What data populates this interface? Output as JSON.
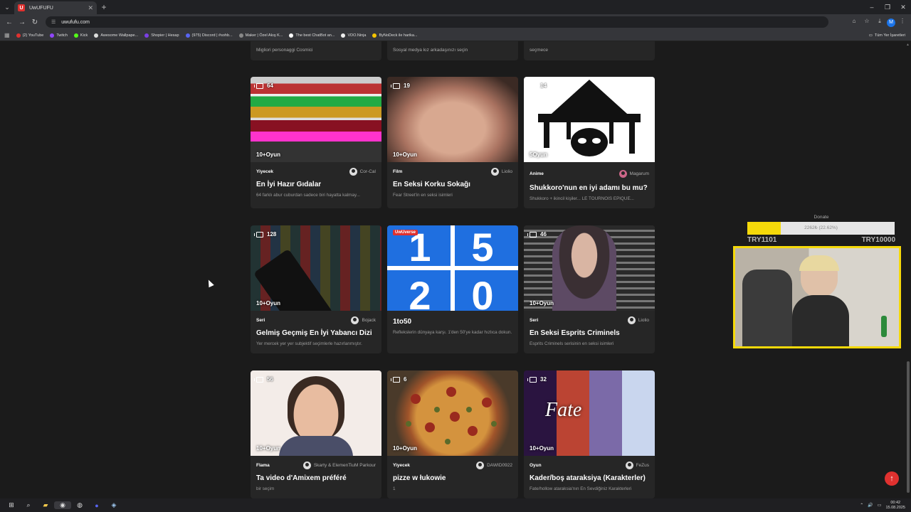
{
  "browser": {
    "tab_title": "UwUFUFU",
    "tab_favicon": "U",
    "url": "uwufufu.com",
    "profile_initial": "M",
    "bookmarks": [
      "(2) YouTube",
      "Twitch",
      "Kick",
      "Awesome Wallpape...",
      "Shopier | Hesap",
      "(975) Discord | #sohb...",
      "Maker | Özel Akış K...",
      "The best ChatBot an...",
      "VDO.Ninja",
      "ByNoDeck ile harika..."
    ],
    "bookmarks_all": "Tüm Yer İşaretleri"
  },
  "top_strip": [
    {
      "desc": "Migliori personaggi Cosmici"
    },
    {
      "desc": "Sosyal medya kız arkadaşınızı seçin"
    },
    {
      "desc": "seçmece"
    }
  ],
  "cards": [
    {
      "count": "64",
      "oyun": "10+Oyun",
      "category": "Yiyecek",
      "author": "Cor-Cal",
      "title": "En İyi Hazır Gıdalar",
      "desc": "64 farklı abur cuburdan sadece biri hayatta kalmay..."
    },
    {
      "count": "19",
      "oyun": "10+Oyun",
      "category": "Film",
      "author": "Liolio",
      "title": "En Seksi Korku Sokağı",
      "desc": "Fear Street'in en seksi isimleri"
    },
    {
      "count": "14",
      "oyun": "5Oyun",
      "category": "Anime",
      "author": "Magarum",
      "title": "Shukkoro'nun en iyi adamı bu mu?",
      "desc": "Shukkoro + ikincil kişiler... LE TOURNOIS EPIQUE..."
    },
    {
      "count": "128",
      "oyun": "10+Oyun",
      "category": "Seri",
      "author": "Bojack",
      "title": "Gelmiş Geçmiş En İyi Yabancı Dizi",
      "desc": "Yer mercek yer yer subjektif seçimlerle hazırlanmıştır."
    },
    {
      "badge": "UwUverse",
      "category": "",
      "author": "",
      "title": "1to50",
      "desc": "Reflekslerin dünyaya karşı. 1'den 50'ye kadar hızlıca dokun."
    },
    {
      "count": "46",
      "oyun": "10+Oyun",
      "category": "Seri",
      "author": "Liolio",
      "title": "En Seksi Esprits Criminels",
      "desc": "Esprits Criminels serisinin en seksi isimleri"
    },
    {
      "count": "56",
      "oyun": "10+Oyun",
      "category": "Flama",
      "author": "Skarty & ElemenTiuM Parkour",
      "title": "Ta video d'Amixem préféré",
      "desc": "bir seçim"
    },
    {
      "count": "6",
      "oyun": "10+Oyun",
      "category": "Yiyecek",
      "author": "DAWID0922",
      "title": "pizze w łukowie",
      "desc": "1"
    },
    {
      "count": "32",
      "oyun": "10+Oyun",
      "category": "Oyun",
      "author": "FeZus",
      "title": "Kader/boş ataraksiya (Karakterler)",
      "desc": "Fate/hollow ataraksia'nın En Sevdiğiniz Karakterleri"
    }
  ],
  "onetofifty_digits": [
    "1",
    "5",
    "2",
    "0"
  ],
  "fate_logo": "Fate",
  "donate": {
    "title": "Donate",
    "progress_text": "2262₺ (22.62%)",
    "progress": 0.2262,
    "left_label": "TRY1101",
    "right_label": "TRY10000"
  },
  "taskbar": {
    "time": "00:42",
    "date": "15.08.2025"
  },
  "colors": {
    "accent": "#e0312f",
    "donate_fill": "#f5d90a",
    "page_bg": "#1b1b1b",
    "card_bg": "#262626"
  }
}
